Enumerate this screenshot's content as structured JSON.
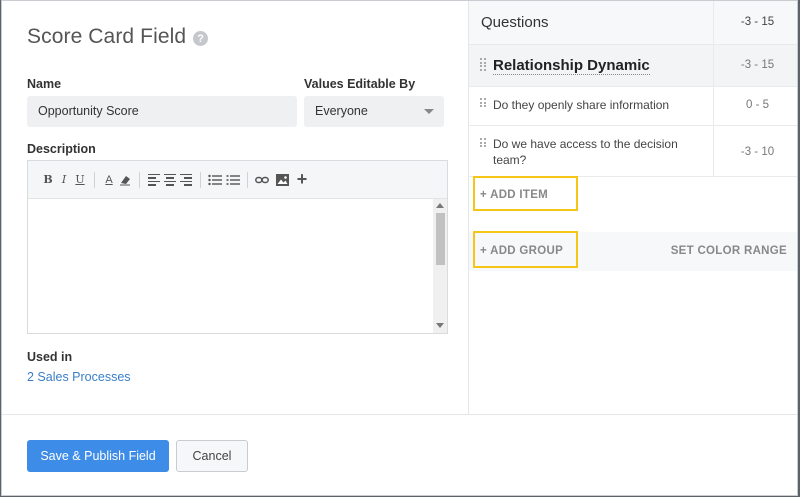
{
  "dialog": {
    "title": "Score Card Field",
    "help_icon": "?"
  },
  "form": {
    "name_label": "Name",
    "name_value": "Opportunity Score",
    "editable_label": "Values Editable By",
    "editable_value": "Everyone",
    "description_label": "Description",
    "used_in_label": "Used in",
    "used_in_link": "2 Sales Processes"
  },
  "toolbar": {
    "bold": "B",
    "italic": "I",
    "underline": "U",
    "font_color": "A",
    "plus": "+"
  },
  "icons": [
    "bold-icon",
    "italic-icon",
    "underline-icon",
    "font-color-icon",
    "eraser-icon",
    "align-left-icon",
    "align-center-icon",
    "align-right-icon",
    "bulleted-list-icon",
    "numbered-list-icon",
    "link-icon",
    "image-icon",
    "plus-icon",
    "help-icon",
    "drag-handle-icon",
    "chevron-down-icon"
  ],
  "footer": {
    "save_label": "Save & Publish Field",
    "cancel_label": "Cancel"
  },
  "questions": {
    "header": "Questions",
    "header_range": "-3 - 15",
    "group": {
      "name": "Relationship Dynamic",
      "range": "-3 - 15"
    },
    "items": [
      {
        "text": "Do they openly share information",
        "range": "0 - 5"
      },
      {
        "text": "Do we have access to the decision team?",
        "range": "-3 - 10"
      }
    ],
    "add_item": "+ ADD ITEM",
    "add_group": "+ ADD GROUP",
    "set_color_range": "SET COLOR RANGE"
  },
  "colors": {
    "primary": "#3d8ce8",
    "link": "#3a7fc8",
    "highlight": "#f5c518"
  }
}
